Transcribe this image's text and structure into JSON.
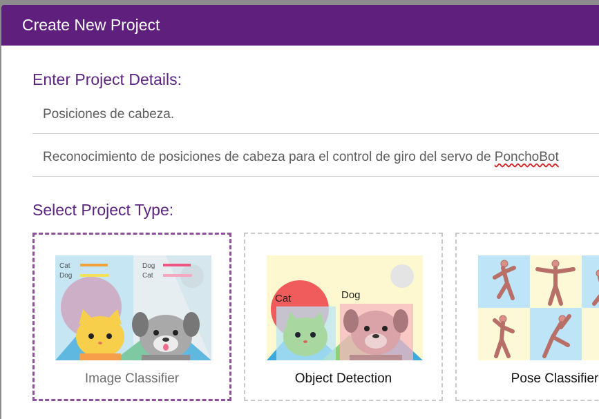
{
  "dialog": {
    "title": "Create New Project",
    "header_color": "#5f1f7d",
    "accent_color": "#5a2480"
  },
  "details": {
    "label": "Enter Project Details:",
    "name_value": "Posiciones de cabeza.",
    "description_prefix": "Reconocimiento de posiciones de cabeza para el control de giro del servo de ",
    "description_misspelled": "PonchoBot"
  },
  "type": {
    "label": "Select Project Type:",
    "cards": [
      {
        "label": "Image Classifier",
        "selected": true,
        "thumb_text": [
          "Cat",
          "Dog",
          "Dog",
          "Cat"
        ]
      },
      {
        "label": "Object Detection",
        "selected": false,
        "thumb_text": [
          "Cat",
          "Dog"
        ]
      },
      {
        "label": "Pose Classifier",
        "selected": false
      }
    ]
  }
}
